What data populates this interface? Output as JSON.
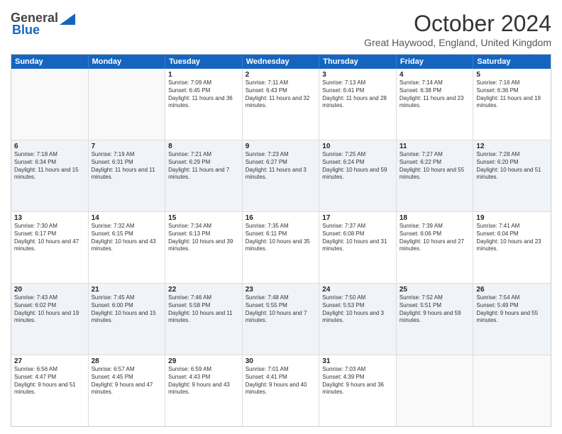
{
  "logo": {
    "general": "General",
    "blue": "Blue"
  },
  "title": "October 2024",
  "location": "Great Haywood, England, United Kingdom",
  "days": [
    "Sunday",
    "Monday",
    "Tuesday",
    "Wednesday",
    "Thursday",
    "Friday",
    "Saturday"
  ],
  "weeks": [
    [
      {
        "day": "",
        "sunrise": "",
        "sunset": "",
        "daylight": "",
        "empty": true
      },
      {
        "day": "",
        "sunrise": "",
        "sunset": "",
        "daylight": "",
        "empty": true
      },
      {
        "day": "1",
        "sunrise": "Sunrise: 7:09 AM",
        "sunset": "Sunset: 6:45 PM",
        "daylight": "Daylight: 11 hours and 36 minutes."
      },
      {
        "day": "2",
        "sunrise": "Sunrise: 7:11 AM",
        "sunset": "Sunset: 6:43 PM",
        "daylight": "Daylight: 11 hours and 32 minutes."
      },
      {
        "day": "3",
        "sunrise": "Sunrise: 7:13 AM",
        "sunset": "Sunset: 6:41 PM",
        "daylight": "Daylight: 11 hours and 28 minutes."
      },
      {
        "day": "4",
        "sunrise": "Sunrise: 7:14 AM",
        "sunset": "Sunset: 6:38 PM",
        "daylight": "Daylight: 11 hours and 23 minutes."
      },
      {
        "day": "5",
        "sunrise": "Sunrise: 7:16 AM",
        "sunset": "Sunset: 6:36 PM",
        "daylight": "Daylight: 11 hours and 19 minutes."
      }
    ],
    [
      {
        "day": "6",
        "sunrise": "Sunrise: 7:18 AM",
        "sunset": "Sunset: 6:34 PM",
        "daylight": "Daylight: 11 hours and 15 minutes."
      },
      {
        "day": "7",
        "sunrise": "Sunrise: 7:19 AM",
        "sunset": "Sunset: 6:31 PM",
        "daylight": "Daylight: 11 hours and 11 minutes."
      },
      {
        "day": "8",
        "sunrise": "Sunrise: 7:21 AM",
        "sunset": "Sunset: 6:29 PM",
        "daylight": "Daylight: 11 hours and 7 minutes."
      },
      {
        "day": "9",
        "sunrise": "Sunrise: 7:23 AM",
        "sunset": "Sunset: 6:27 PM",
        "daylight": "Daylight: 11 hours and 3 minutes."
      },
      {
        "day": "10",
        "sunrise": "Sunrise: 7:25 AM",
        "sunset": "Sunset: 6:24 PM",
        "daylight": "Daylight: 10 hours and 59 minutes."
      },
      {
        "day": "11",
        "sunrise": "Sunrise: 7:27 AM",
        "sunset": "Sunset: 6:22 PM",
        "daylight": "Daylight: 10 hours and 55 minutes."
      },
      {
        "day": "12",
        "sunrise": "Sunrise: 7:28 AM",
        "sunset": "Sunset: 6:20 PM",
        "daylight": "Daylight: 10 hours and 51 minutes."
      }
    ],
    [
      {
        "day": "13",
        "sunrise": "Sunrise: 7:30 AM",
        "sunset": "Sunset: 6:17 PM",
        "daylight": "Daylight: 10 hours and 47 minutes."
      },
      {
        "day": "14",
        "sunrise": "Sunrise: 7:32 AM",
        "sunset": "Sunset: 6:15 PM",
        "daylight": "Daylight: 10 hours and 43 minutes."
      },
      {
        "day": "15",
        "sunrise": "Sunrise: 7:34 AM",
        "sunset": "Sunset: 6:13 PM",
        "daylight": "Daylight: 10 hours and 39 minutes."
      },
      {
        "day": "16",
        "sunrise": "Sunrise: 7:35 AM",
        "sunset": "Sunset: 6:11 PM",
        "daylight": "Daylight: 10 hours and 35 minutes."
      },
      {
        "day": "17",
        "sunrise": "Sunrise: 7:37 AM",
        "sunset": "Sunset: 6:08 PM",
        "daylight": "Daylight: 10 hours and 31 minutes."
      },
      {
        "day": "18",
        "sunrise": "Sunrise: 7:39 AM",
        "sunset": "Sunset: 6:06 PM",
        "daylight": "Daylight: 10 hours and 27 minutes."
      },
      {
        "day": "19",
        "sunrise": "Sunrise: 7:41 AM",
        "sunset": "Sunset: 6:04 PM",
        "daylight": "Daylight: 10 hours and 23 minutes."
      }
    ],
    [
      {
        "day": "20",
        "sunrise": "Sunrise: 7:43 AM",
        "sunset": "Sunset: 6:02 PM",
        "daylight": "Daylight: 10 hours and 19 minutes."
      },
      {
        "day": "21",
        "sunrise": "Sunrise: 7:45 AM",
        "sunset": "Sunset: 6:00 PM",
        "daylight": "Daylight: 10 hours and 15 minutes."
      },
      {
        "day": "22",
        "sunrise": "Sunrise: 7:46 AM",
        "sunset": "Sunset: 5:58 PM",
        "daylight": "Daylight: 10 hours and 11 minutes."
      },
      {
        "day": "23",
        "sunrise": "Sunrise: 7:48 AM",
        "sunset": "Sunset: 5:55 PM",
        "daylight": "Daylight: 10 hours and 7 minutes."
      },
      {
        "day": "24",
        "sunrise": "Sunrise: 7:50 AM",
        "sunset": "Sunset: 5:53 PM",
        "daylight": "Daylight: 10 hours and 3 minutes."
      },
      {
        "day": "25",
        "sunrise": "Sunrise: 7:52 AM",
        "sunset": "Sunset: 5:51 PM",
        "daylight": "Daylight: 9 hours and 59 minutes."
      },
      {
        "day": "26",
        "sunrise": "Sunrise: 7:54 AM",
        "sunset": "Sunset: 5:49 PM",
        "daylight": "Daylight: 9 hours and 55 minutes."
      }
    ],
    [
      {
        "day": "27",
        "sunrise": "Sunrise: 6:56 AM",
        "sunset": "Sunset: 4:47 PM",
        "daylight": "Daylight: 9 hours and 51 minutes."
      },
      {
        "day": "28",
        "sunrise": "Sunrise: 6:57 AM",
        "sunset": "Sunset: 4:45 PM",
        "daylight": "Daylight: 9 hours and 47 minutes."
      },
      {
        "day": "29",
        "sunrise": "Sunrise: 6:59 AM",
        "sunset": "Sunset: 4:43 PM",
        "daylight": "Daylight: 9 hours and 43 minutes."
      },
      {
        "day": "30",
        "sunrise": "Sunrise: 7:01 AM",
        "sunset": "Sunset: 4:41 PM",
        "daylight": "Daylight: 9 hours and 40 minutes."
      },
      {
        "day": "31",
        "sunrise": "Sunrise: 7:03 AM",
        "sunset": "Sunset: 4:39 PM",
        "daylight": "Daylight: 9 hours and 36 minutes."
      },
      {
        "day": "",
        "sunrise": "",
        "sunset": "",
        "daylight": "",
        "empty": true
      },
      {
        "day": "",
        "sunrise": "",
        "sunset": "",
        "daylight": "",
        "empty": true
      }
    ]
  ]
}
